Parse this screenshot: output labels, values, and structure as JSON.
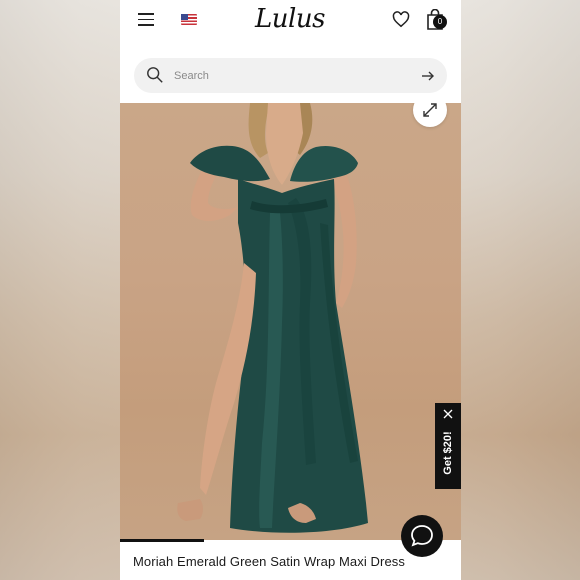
{
  "header": {
    "logo_text": "Lulus",
    "menu_icon": "hamburger-icon",
    "flag_icon": "us-flag-icon",
    "wishlist_icon": "heart-icon",
    "bag_icon": "shopping-bag-icon",
    "bag_count": "0"
  },
  "search": {
    "placeholder": "Search",
    "value": "",
    "submit_icon": "arrow-right-icon"
  },
  "product": {
    "title": "Moriah Emerald Green Satin Wrap Maxi Dress",
    "image_alt": "emerald green satin wrap maxi dress photo"
  },
  "promo": {
    "label": "Get $20!",
    "close_icon": "close-icon"
  },
  "chat": {
    "icon": "chat-bubble-icon"
  },
  "colors": {
    "background": "#ffffff",
    "dress": "#1f4a45",
    "photo_backdrop": "#c9a385",
    "dark": "#111111"
  }
}
